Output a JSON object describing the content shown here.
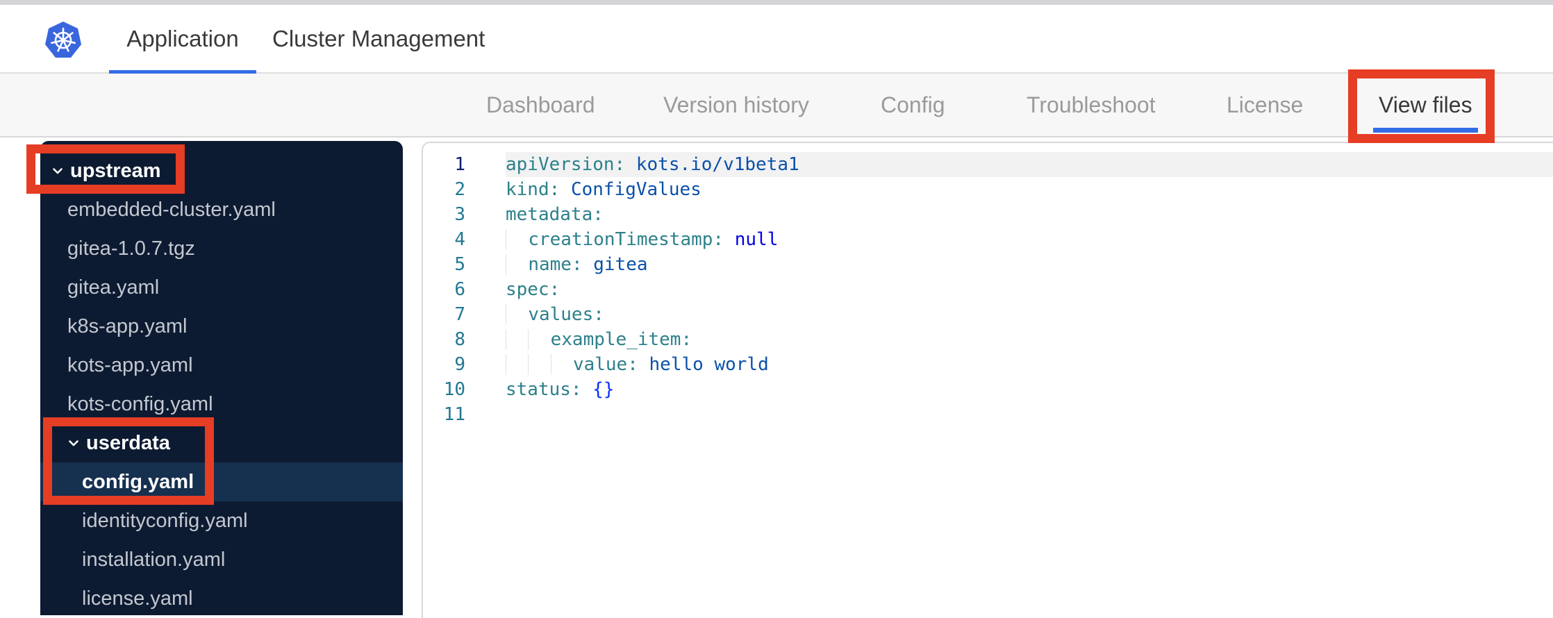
{
  "app": {
    "logo": "kubernetes-logo",
    "tabs": [
      {
        "label": "Application",
        "active": true
      },
      {
        "label": "Cluster Management",
        "active": false
      }
    ]
  },
  "nav": {
    "tabs": [
      {
        "label": "Dashboard",
        "active": false
      },
      {
        "label": "Version history",
        "active": false
      },
      {
        "label": "Config",
        "active": false
      },
      {
        "label": "Troubleshoot",
        "active": false
      },
      {
        "label": "License",
        "active": false
      },
      {
        "label": "View files",
        "active": true
      }
    ]
  },
  "file_tree": {
    "items": [
      {
        "label": "upstream",
        "type": "folder",
        "level": 0,
        "expanded": true,
        "selected": false
      },
      {
        "label": "embedded-cluster.yaml",
        "type": "file",
        "level": 1,
        "selected": false
      },
      {
        "label": "gitea-1.0.7.tgz",
        "type": "file",
        "level": 1,
        "selected": false
      },
      {
        "label": "gitea.yaml",
        "type": "file",
        "level": 1,
        "selected": false
      },
      {
        "label": "k8s-app.yaml",
        "type": "file",
        "level": 1,
        "selected": false
      },
      {
        "label": "kots-app.yaml",
        "type": "file",
        "level": 1,
        "selected": false
      },
      {
        "label": "kots-config.yaml",
        "type": "file",
        "level": 1,
        "selected": false
      },
      {
        "label": "userdata",
        "type": "folder",
        "level": 1,
        "expanded": true,
        "selected": false
      },
      {
        "label": "config.yaml",
        "type": "file",
        "level": 2,
        "selected": true
      },
      {
        "label": "identityconfig.yaml",
        "type": "file",
        "level": 2,
        "selected": false
      },
      {
        "label": "installation.yaml",
        "type": "file",
        "level": 2,
        "selected": false
      },
      {
        "label": "license.yaml",
        "type": "file",
        "level": 2,
        "selected": false
      }
    ]
  },
  "editor": {
    "language": "yaml",
    "active_line": 1,
    "lines": [
      {
        "n": "1",
        "tokens": [
          {
            "t": "key",
            "v": "apiVersion"
          },
          {
            "t": "colon",
            "v": ": "
          },
          {
            "t": "str",
            "v": "kots.io/v1beta1"
          }
        ]
      },
      {
        "n": "2",
        "tokens": [
          {
            "t": "key",
            "v": "kind"
          },
          {
            "t": "colon",
            "v": ": "
          },
          {
            "t": "str",
            "v": "ConfigValues"
          }
        ]
      },
      {
        "n": "3",
        "tokens": [
          {
            "t": "key",
            "v": "metadata"
          },
          {
            "t": "colon",
            "v": ":"
          }
        ]
      },
      {
        "n": "4",
        "tokens": [
          {
            "t": "guide",
            "v": "  "
          },
          {
            "t": "key",
            "v": "creationTimestamp"
          },
          {
            "t": "colon",
            "v": ": "
          },
          {
            "t": "kw",
            "v": "null"
          }
        ]
      },
      {
        "n": "5",
        "tokens": [
          {
            "t": "guide",
            "v": "  "
          },
          {
            "t": "key",
            "v": "name"
          },
          {
            "t": "colon",
            "v": ": "
          },
          {
            "t": "str",
            "v": "gitea"
          }
        ]
      },
      {
        "n": "6",
        "tokens": [
          {
            "t": "key",
            "v": "spec"
          },
          {
            "t": "colon",
            "v": ":"
          }
        ]
      },
      {
        "n": "7",
        "tokens": [
          {
            "t": "guide",
            "v": "  "
          },
          {
            "t": "key",
            "v": "values"
          },
          {
            "t": "colon",
            "v": ":"
          }
        ]
      },
      {
        "n": "8",
        "tokens": [
          {
            "t": "guide",
            "v": "  "
          },
          {
            "t": "guide",
            "v": "  "
          },
          {
            "t": "key",
            "v": "example_item"
          },
          {
            "t": "colon",
            "v": ":"
          }
        ]
      },
      {
        "n": "9",
        "tokens": [
          {
            "t": "guide",
            "v": "  "
          },
          {
            "t": "guide",
            "v": "  "
          },
          {
            "t": "guide",
            "v": "  "
          },
          {
            "t": "key",
            "v": "value"
          },
          {
            "t": "colon",
            "v": ": "
          },
          {
            "t": "str",
            "v": "hello world"
          }
        ]
      },
      {
        "n": "10",
        "tokens": [
          {
            "t": "key",
            "v": "status"
          },
          {
            "t": "colon",
            "v": ": "
          },
          {
            "t": "punct",
            "v": "{}"
          }
        ]
      },
      {
        "n": "11",
        "tokens": []
      }
    ]
  },
  "annotations": [
    {
      "target": "upstream-folder"
    },
    {
      "target": "userdata-config-yaml"
    },
    {
      "target": "view-files-tab"
    }
  ],
  "colors": {
    "accent_blue": "#326de6",
    "annotation_red": "#e63d25",
    "sidebar_bg": "#0d1b32",
    "sidebar_selected_bg": "#16304f",
    "code_key": "#2d808a",
    "code_value": "#0a51a8",
    "code_keyword": "#0000e6",
    "code_bracket": "#0431fa",
    "line_number": "#237893",
    "active_line_number": "#0b216f"
  }
}
